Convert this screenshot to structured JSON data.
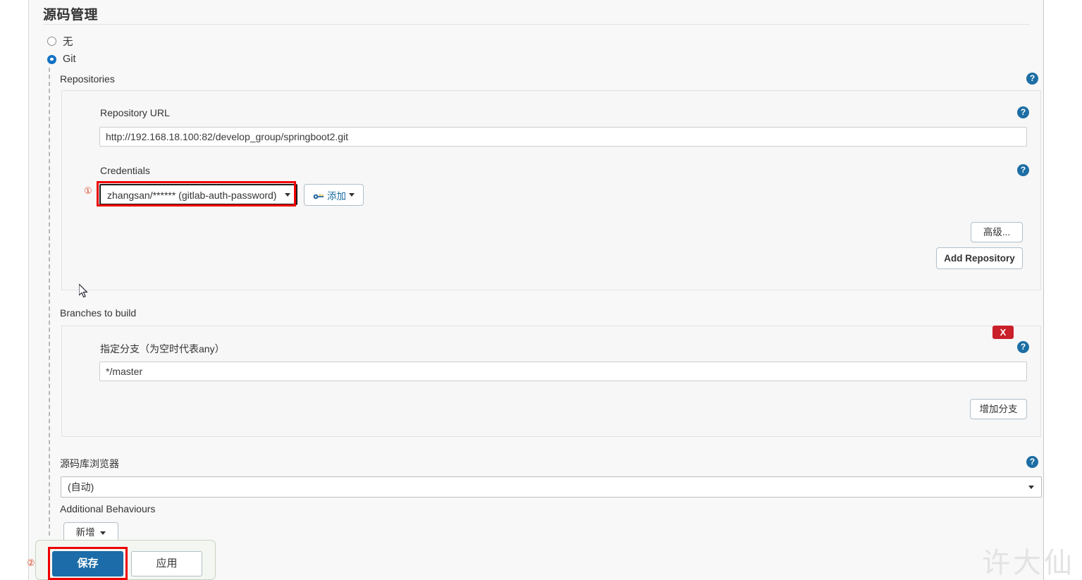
{
  "page": {
    "section_title": "源码管理",
    "watermark": "许大仙"
  },
  "scm_options": [
    {
      "label": "无",
      "selected": false
    },
    {
      "label": "Git",
      "selected": true
    }
  ],
  "repositories": {
    "label": "Repositories",
    "help": "?",
    "repository_url": {
      "label": "Repository URL",
      "value": "http://192.168.18.100:82/develop_group/springboot2.git",
      "help": "?"
    },
    "credentials": {
      "label": "Credentials",
      "selected": "zhangsan/****** (gitlab-auth-password)",
      "help": "?",
      "add_button": "添加",
      "add_icon": "key-icon",
      "marker": "①"
    },
    "advanced_button": "高级...",
    "add_repository_button": "Add Repository"
  },
  "branches": {
    "label": "Branches to build",
    "delete_button": "X",
    "help": "?",
    "specifier": {
      "label": "指定分支（为空时代表any）",
      "value": "*/master"
    },
    "add_branch_button": "增加分支"
  },
  "browser": {
    "label": "源码库浏览器",
    "selected": "(自动)",
    "help": "?"
  },
  "additional_behaviours": {
    "label": "Additional Behaviours",
    "add_button": "新增"
  },
  "footer": {
    "save_button": "保存",
    "apply_button": "应用",
    "marker": "②"
  }
}
